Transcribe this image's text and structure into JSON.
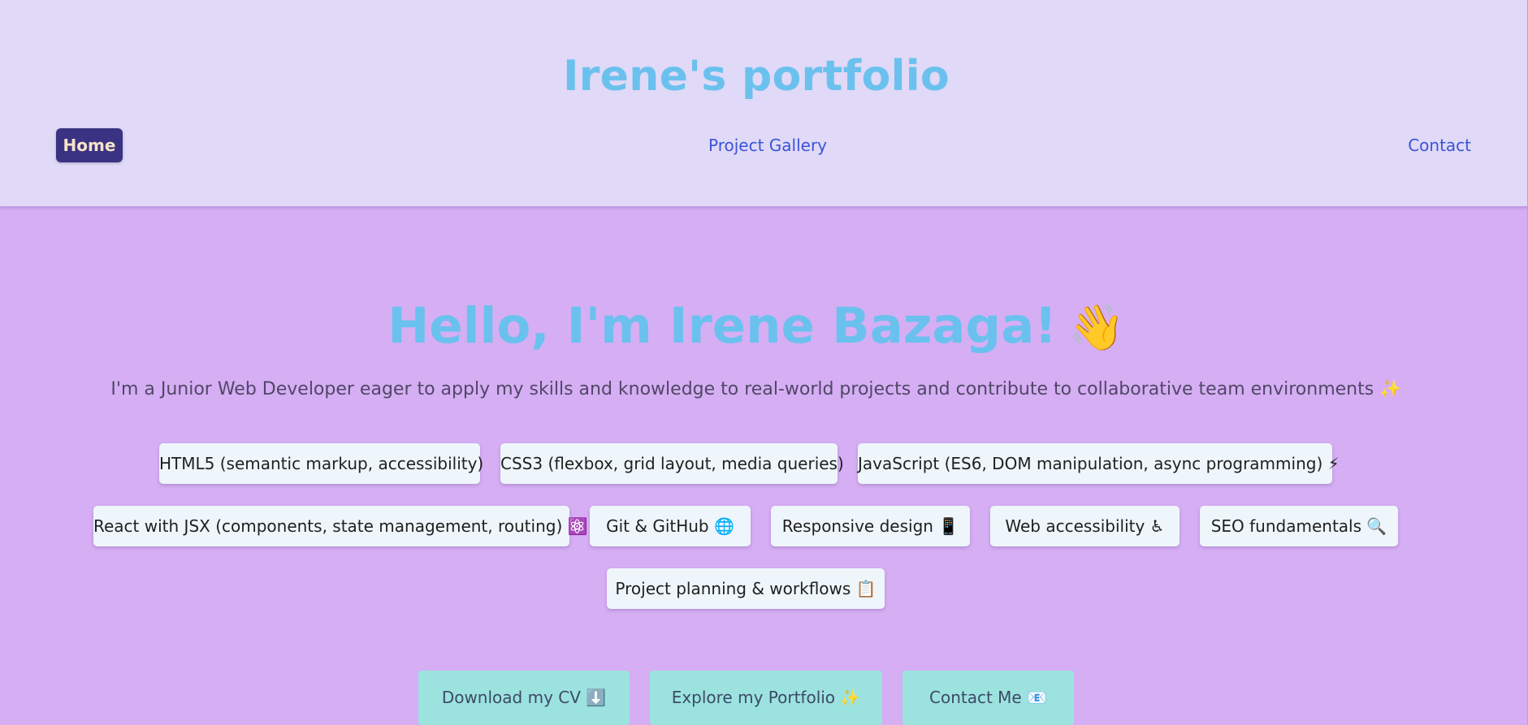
{
  "header": {
    "title": "Irene's portfolio",
    "nav": {
      "home": "Home",
      "gallery": "Project Gallery",
      "contact": "Contact"
    }
  },
  "hero": {
    "title": "Hello, I'm Irene Bazaga!",
    "title_emoji": "👋",
    "subtitle": "I'm a Junior Web Developer eager to apply my skills and knowledge to real-world projects and contribute to collaborative team environments ✨"
  },
  "skills": [
    "HTML5 (semantic markup, accessibility)",
    "CSS3 (flexbox, grid layout, media queries)",
    "JavaScript (ES6, DOM manipulation, async programming) ⚡",
    "React with JSX (components, state management, routing) ⚛️",
    "Git & GitHub 🌐",
    "Responsive design 📱",
    "Web accessibility ♿",
    "SEO fundamentals 🔍",
    "Project planning & workflows 📋"
  ],
  "actions": {
    "download_cv": "Download my CV ⬇️",
    "explore_portfolio": "Explore my Portfolio ✨",
    "contact_me": "Contact Me 📧"
  },
  "colors": {
    "header_bg": "#e0d9f7",
    "page_bg": "#d6aef4",
    "title_blue": "#6bc1ee",
    "nav_link": "#3a55d6",
    "nav_active_bg": "#3a3282",
    "chip_bg": "#eef6fb",
    "button_bg": "#9ce3e0"
  }
}
